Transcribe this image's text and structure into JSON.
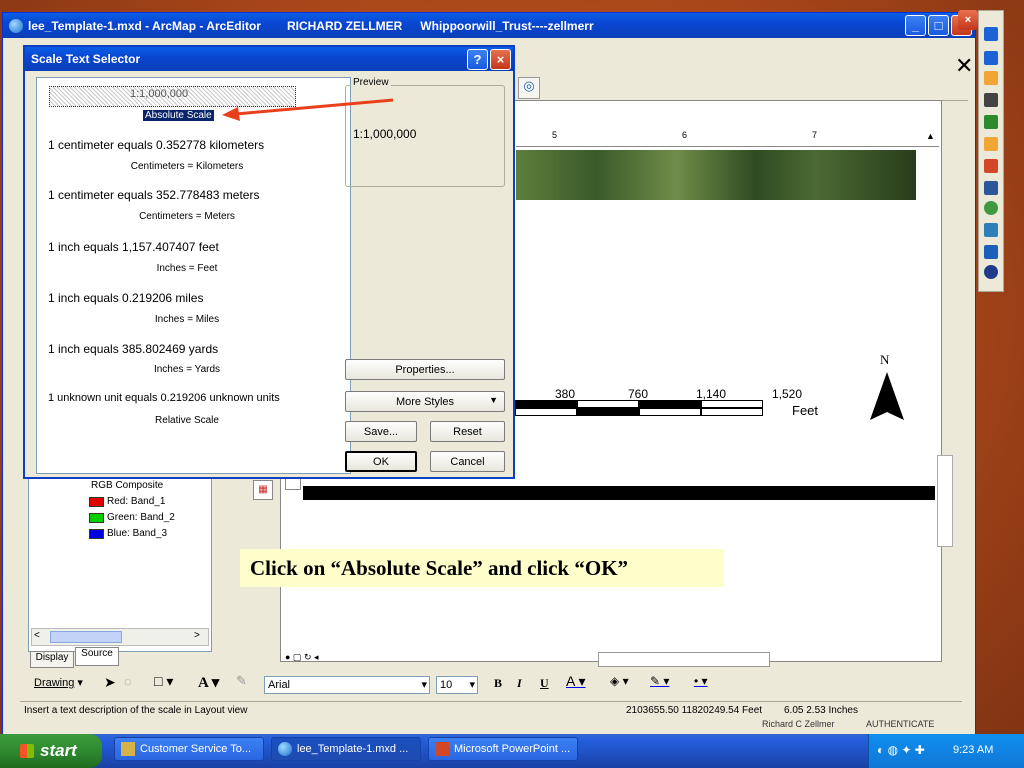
{
  "app_window": {
    "title": "lee_Template-1.mxd - ArcMap - ArcEditor",
    "user": "RICHARD ZELLMER",
    "path": "Whippoorwill_Trust----zellmerr"
  },
  "dialog": {
    "title": "Scale Text Selector",
    "help_label": "?",
    "close_label": "×",
    "styles": [
      {
        "text": "1:1,000,000",
        "label": "Absolute Scale",
        "selected": true
      },
      {
        "text": "1 centimeter equals 0.352778 kilometers",
        "label": "Centimeters = Kilometers"
      },
      {
        "text": "1 centimeter equals 352.778483 meters",
        "label": "Centimeters = Meters"
      },
      {
        "text": "1 inch equals 1,157.407407 feet",
        "label": "Inches = Feet"
      },
      {
        "text": "1 inch equals 0.219206 miles",
        "label": "Inches = Miles"
      },
      {
        "text": "1 inch equals 385.802469 yards",
        "label": "Inches = Yards"
      },
      {
        "text": "1 unknown unit equals 0.219206 unknown units",
        "label": "Relative Scale"
      }
    ],
    "preview_label": "Preview",
    "preview_text": "1:1,000,000",
    "properties_label": "Properties...",
    "more_styles_label": "More Styles",
    "save_label": "Save...",
    "reset_label": "Reset",
    "ok_label": "OK",
    "cancel_label": "Cancel"
  },
  "map": {
    "ruler_ticks": [
      "5",
      "6",
      "7"
    ],
    "scalebar_labels": [
      "380",
      "760",
      "1,140",
      "1,520"
    ],
    "scalebar_units": "Feet",
    "north_label": "N"
  },
  "toc": {
    "layer_title": "RGB Composite",
    "bands": [
      {
        "label": "Red:   Band_1",
        "color": "#e00000"
      },
      {
        "label": "Green: Band_2",
        "color": "#00d000"
      },
      {
        "label": "Blue:   Band_3",
        "color": "#0000e0"
      }
    ],
    "tabs": [
      "Display",
      "Source"
    ]
  },
  "drawing_toolbar": {
    "drawing_label": "Drawing",
    "font_name": "Arial",
    "font_size": "10",
    "bold": "B",
    "italic": "I",
    "underline": "U"
  },
  "status": {
    "message": "Insert a text description of the scale in Layout view",
    "coords": "2103655.50  11820249.54 Feet",
    "page_coords": "6.05  2.53 Inches",
    "behind_text_1": "Richard C Zellmer",
    "behind_text_2": "AUTHENTICATE"
  },
  "caption": "Click on “Absolute Scale” and click “OK”",
  "taskbar": {
    "start_label": "start",
    "tasks": [
      "Customer Service To...",
      "lee_Template-1.mxd ...",
      "Microsoft PowerPoint ..."
    ],
    "clock": "9:23 AM"
  },
  "colors": {
    "arrow": "#e8401a",
    "selection": "#0a246a",
    "caption_bg": "#ffffcc"
  }
}
